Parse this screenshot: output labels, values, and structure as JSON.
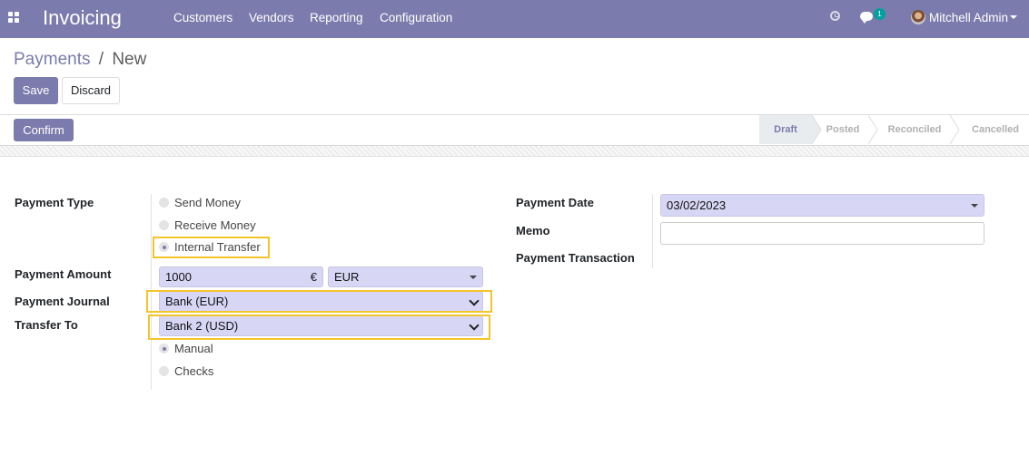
{
  "app": {
    "title": "Invoicing"
  },
  "menu": [
    "Customers",
    "Vendors",
    "Reporting",
    "Configuration"
  ],
  "systray": {
    "chat_count": "1",
    "user_name": "Mitchell Admin"
  },
  "breadcrumb": {
    "parent": "Payments",
    "separator": "/",
    "current": "New"
  },
  "buttons": {
    "save": "Save",
    "discard": "Discard",
    "confirm": "Confirm"
  },
  "status": {
    "stages": [
      "Draft",
      "Posted",
      "Reconciled",
      "Cancelled"
    ],
    "active": "Draft"
  },
  "form": {
    "payment_type": {
      "label": "Payment Type",
      "options": [
        "Send Money",
        "Receive Money",
        "Internal Transfer"
      ],
      "selected": "Internal Transfer"
    },
    "payment_amount": {
      "label": "Payment Amount",
      "value": "1000",
      "currency_symbol": "€",
      "currency": "EUR"
    },
    "payment_journal": {
      "label": "Payment Journal",
      "value": "Bank (EUR)"
    },
    "transfer_to": {
      "label": "Transfer To",
      "value": "Bank 2 (USD)"
    },
    "payment_method": {
      "options": [
        "Manual",
        "Checks"
      ],
      "selected": "Manual"
    },
    "payment_date": {
      "label": "Payment Date",
      "value": "03/02/2023"
    },
    "memo": {
      "label": "Memo",
      "value": ""
    },
    "payment_transaction": {
      "label": "Payment Transaction"
    }
  },
  "colors": {
    "brand": "#7c7bad",
    "highlight": "#f4c52b",
    "field_bg": "#d8d6f5"
  }
}
